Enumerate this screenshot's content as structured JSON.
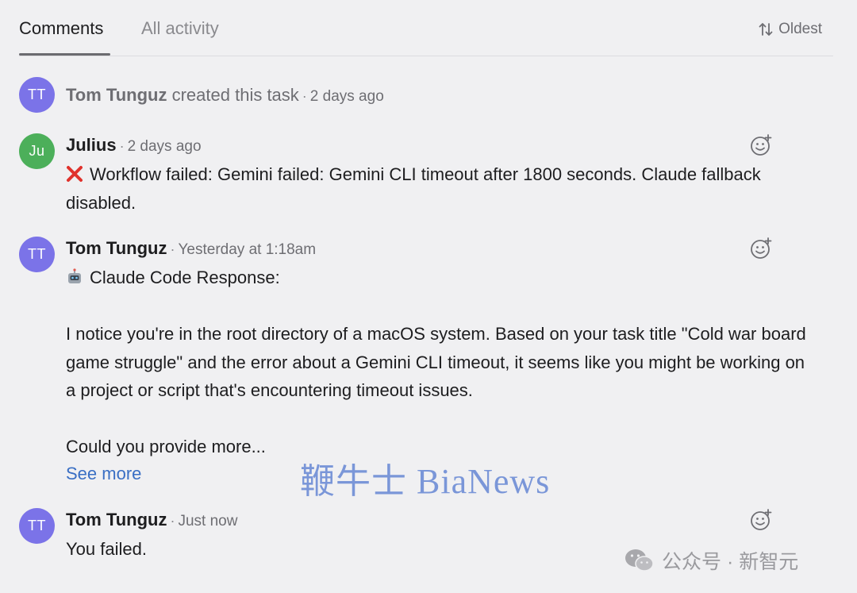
{
  "tabs": {
    "comments": "Comments",
    "all_activity": "All activity"
  },
  "sort": {
    "label": "Oldest",
    "icon": "sort-arrows-icon"
  },
  "feed": [
    {
      "avatar": "TT",
      "avatar_color": "#7b73e8",
      "author": "Tom Tunguz",
      "action": "created this task",
      "time": "2 days ago"
    },
    {
      "avatar": "Ju",
      "avatar_color": "#4caf5a",
      "author": "Julius",
      "time": "2 days ago",
      "icon": "red-x-icon",
      "text": "Workflow failed: Gemini failed: Gemini CLI timeout after 1800 seconds. Claude fallback disabled."
    },
    {
      "avatar": "TT",
      "avatar_color": "#7b73e8",
      "author": "Tom Tunguz",
      "time": "Yesterday at 1:18am",
      "icon": "robot-icon",
      "heading": "Claude Code Response:",
      "paragraph1": "I notice you're in the root directory of a macOS system. Based on your task title \"Cold war board game struggle\" and the error about a Gemini CLI timeout, it seems like you might be working on a project or script that's encountering timeout issues.",
      "paragraph2": "Could you provide more...",
      "see_more": "See more"
    },
    {
      "avatar": "TT",
      "avatar_color": "#7b73e8",
      "author": "Tom Tunguz",
      "time": "Just now",
      "text": "You failed."
    }
  ],
  "watermarks": {
    "center": "鞭牛士 BiaNews",
    "corner": "公众号 · 新智元"
  }
}
